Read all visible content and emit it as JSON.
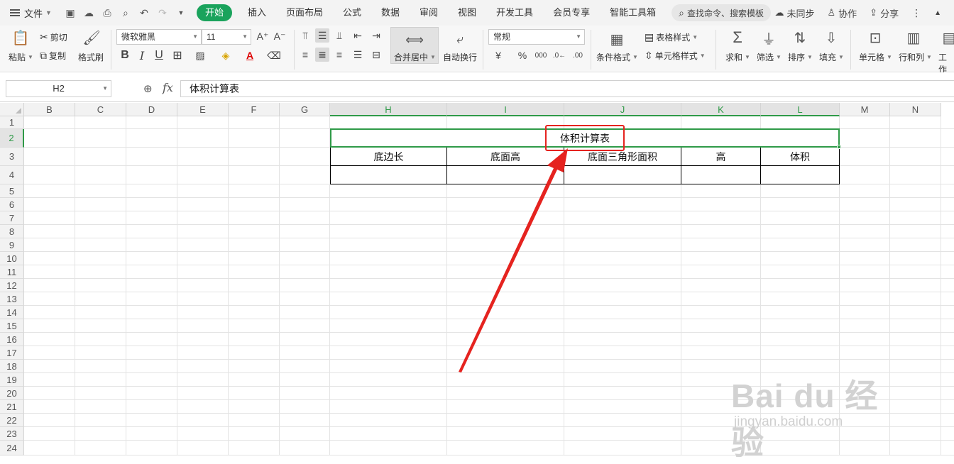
{
  "menubar": {
    "file_label": "文件",
    "tabs": [
      {
        "label": "开始",
        "active": true
      },
      {
        "label": "插入"
      },
      {
        "label": "页面布局"
      },
      {
        "label": "公式"
      },
      {
        "label": "数据"
      },
      {
        "label": "审阅"
      },
      {
        "label": "视图"
      },
      {
        "label": "开发工具"
      },
      {
        "label": "会员专享"
      },
      {
        "label": "智能工具箱"
      }
    ],
    "search_placeholder": "查找命令、搜索模板",
    "right": {
      "sync": "未同步",
      "collab": "协作",
      "share": "分享"
    }
  },
  "ribbon": {
    "paste": "粘贴",
    "cut": "剪切",
    "copy": "复制",
    "format_painter": "格式刷",
    "font_name": "微软雅黑",
    "font_size": "11",
    "merge_center": "合并居中",
    "wrap_text": "自动换行",
    "number_format": "常规",
    "conditional_format": "条件格式",
    "table_style": "表格样式",
    "cell_style": "单元格样式",
    "sum": "求和",
    "filter": "筛选",
    "sort": "排序",
    "fill": "填充",
    "cells": "单元格",
    "rows_cols": "行和列",
    "worksheet": "工作"
  },
  "formula_bar": {
    "name_box": "H2",
    "fx": "fx",
    "content": "体积计算表"
  },
  "sheet": {
    "columns": [
      "B",
      "C",
      "D",
      "E",
      "F",
      "G",
      "H",
      "I",
      "J",
      "K",
      "L",
      "M",
      "N"
    ],
    "rows": [
      "1",
      "2",
      "3",
      "4",
      "5",
      "6",
      "7",
      "8",
      "9",
      "10",
      "11",
      "12",
      "13",
      "14",
      "15",
      "16",
      "17",
      "18",
      "19",
      "20",
      "21",
      "22",
      "23",
      "24"
    ],
    "selected_cell": "H2",
    "title": "体积计算表",
    "headers": [
      "底边长",
      "底面高",
      "底面三角形面积",
      "高",
      "体积"
    ]
  },
  "watermark": {
    "main": "Bai du 经验",
    "sub": "jingyan.baidu.com"
  },
  "colors": {
    "accent_green": "#1aa35c",
    "selection_green": "#2f9a48",
    "annotation_red": "#e5231f"
  }
}
